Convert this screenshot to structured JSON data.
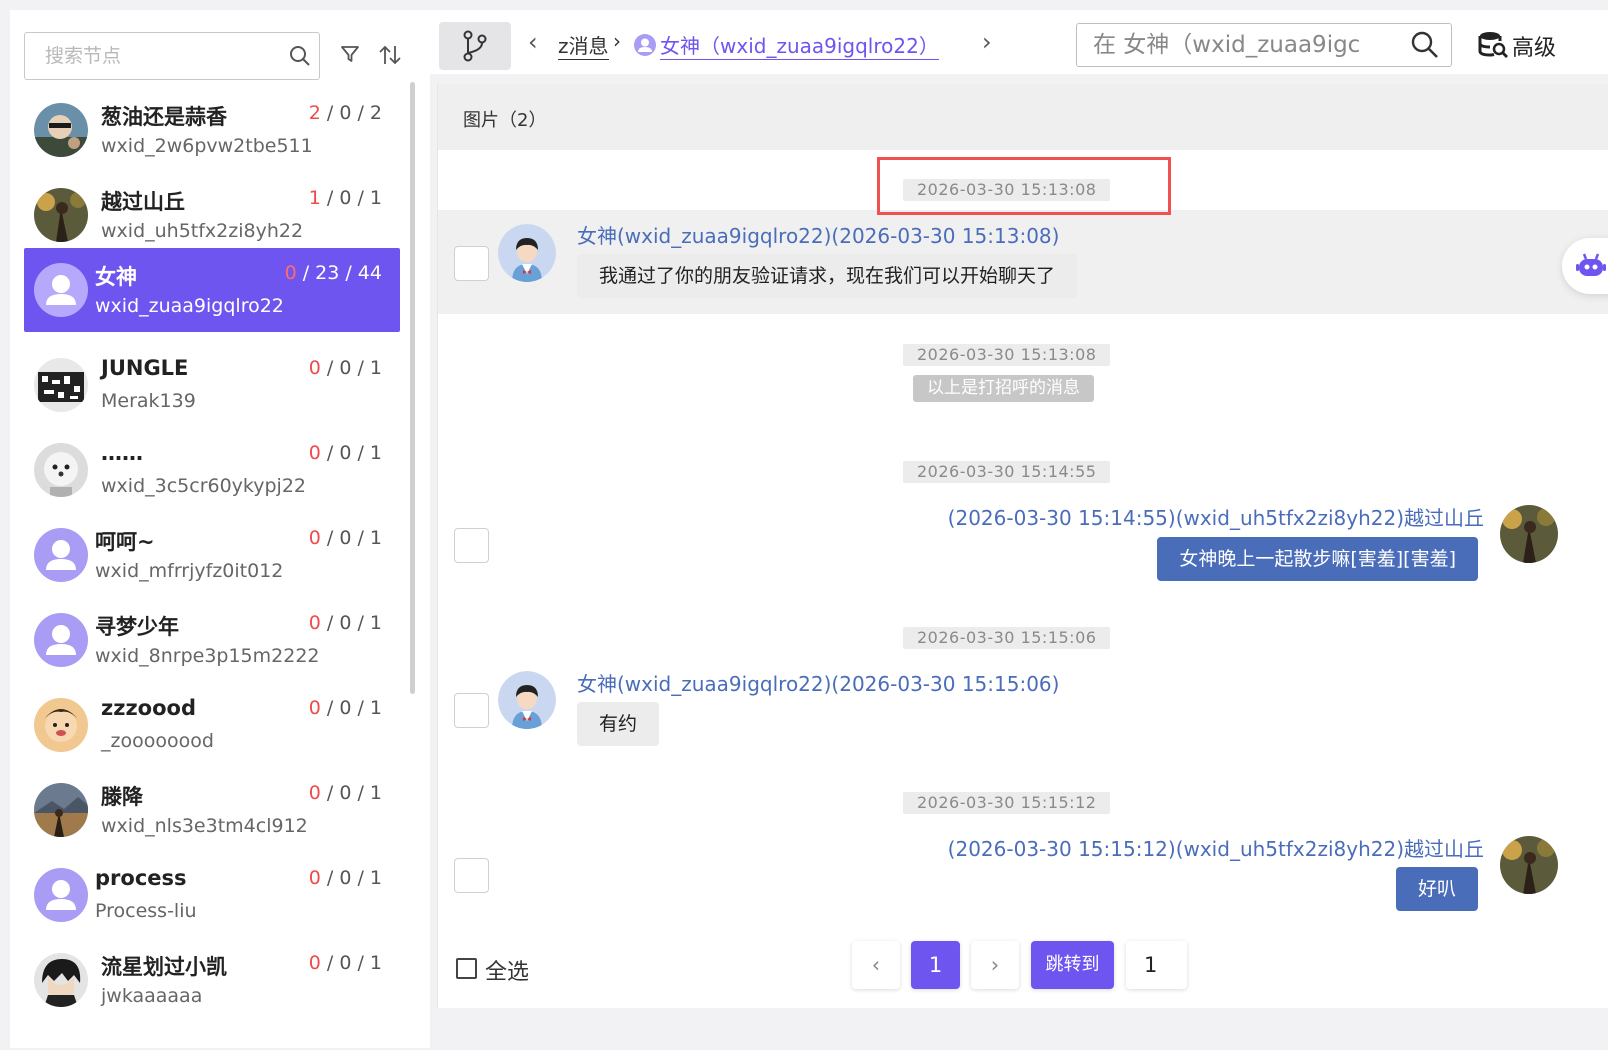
{
  "sidebar": {
    "search_placeholder": "搜索节点",
    "contacts": [
      {
        "name": "葱油还是蒜香",
        "sub": "wxid_2w6pvw2tbe511",
        "red": "2",
        "rest": " / 0 / 2"
      },
      {
        "name": "越过山丘",
        "sub": "wxid_uh5tfx2zi8yh22",
        "red": "1",
        "rest": " / 0 / 1"
      },
      {
        "name": "女神",
        "sub": "wxid_zuaa9igqlro22",
        "red": "0",
        "rest": " / 23 / 44"
      },
      {
        "name": "JUNGLE",
        "sub": "Merak139",
        "red": "0",
        "rest": " / 0 / 1"
      },
      {
        "name": "……",
        "sub": "wxid_3c5cr60ykypj22",
        "red": "0",
        "rest": " / 0 / 1"
      },
      {
        "name": "呵呵~",
        "sub": "wxid_mfrrjyfz0it012",
        "red": "0",
        "rest": " / 0 / 1"
      },
      {
        "name": "寻梦少年",
        "sub": "wxid_8nrpe3p15m2222",
        "red": "0",
        "rest": " / 0 / 1"
      },
      {
        "name": "zzzoood",
        "sub": "_zoooooood",
        "red": "0",
        "rest": " / 0 / 1"
      },
      {
        "name": "滕降",
        "sub": "wxid_nls3e3tm4cl912",
        "red": "0",
        "rest": " / 0 / 1"
      },
      {
        "name": "process",
        "sub": "Process-liu",
        "red": "0",
        "rest": " / 0 / 1"
      },
      {
        "name": "流星划过小凯",
        "sub": "jwkaaaaaa",
        "red": "0",
        "rest": " / 0 / 1"
      }
    ]
  },
  "topbar": {
    "crumb1": "z消息",
    "crumb_sep": "›",
    "crumb2": "女神（wxid_zuaa9igqlro22）",
    "search_placeholder": "在 女神（wxid_zuaa9igc",
    "advanced": "高级"
  },
  "main": {
    "header": "图片（2）",
    "messages": [
      {
        "time": "2026-03-30 15:13:08",
        "sender": "女神(wxid_zuaa9igqlro22)(2026-03-30 15:13:08)",
        "text": "我通过了你的朋友验证请求，现在我们可以开始聊天了"
      },
      {
        "time": "2026-03-30 15:13:08",
        "tag": "以上是打招呼的消息"
      },
      {
        "time": "2026-03-30 15:14:55",
        "sender": "(2026-03-30 15:14:55)(wxid_uh5tfx2zi8yh22)越过山丘",
        "text": "女神晚上一起散步嘛[害羞][害羞]"
      },
      {
        "time": "2026-03-30 15:15:06",
        "sender": "女神(wxid_zuaa9igqlro22)(2026-03-30 15:15:06)",
        "text": "有约"
      },
      {
        "time": "2026-03-30 15:15:12",
        "sender": "(2026-03-30 15:15:12)(wxid_uh5tfx2zi8yh22)越过山丘",
        "text": "好叭"
      }
    ]
  },
  "footer": {
    "select_all": "全选",
    "prev": "‹",
    "current_page": "1",
    "next": "›",
    "jump_label": "跳转到",
    "jump_value": "1"
  },
  "colors": {
    "accent": "#6e55ef",
    "link": "#4a6dba",
    "counter_red": "#ef4b4b",
    "highlight_box": "#ef5050"
  }
}
